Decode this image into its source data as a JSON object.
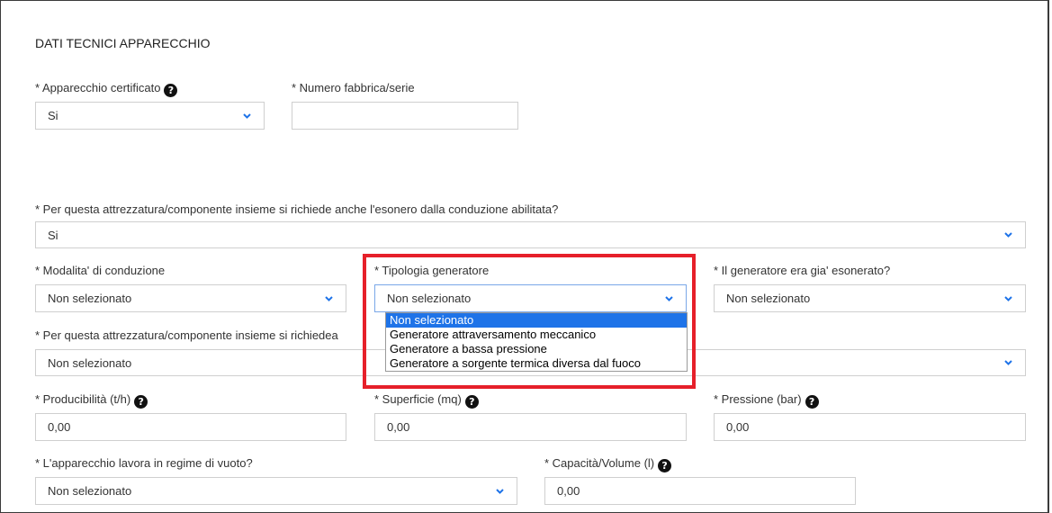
{
  "section_title": "DATI TECNICI APPARECCHIO",
  "fields": {
    "apparecchio_certificato": {
      "label": "* Apparecchio certificato",
      "value": "Si"
    },
    "numero_fabbrica": {
      "label": "* Numero fabbrica/serie",
      "value": ""
    },
    "esonero_conduzione": {
      "label": "* Per questa attrezzatura/componente insieme si richiede anche l'esonero dalla conduzione abilitata?",
      "value": "Si"
    },
    "modalita_conduzione": {
      "label": "* Modalita' di conduzione",
      "value": "Non selezionato"
    },
    "tipologia_generatore": {
      "label": "* Tipologia generatore",
      "value": "Non selezionato",
      "options": [
        "Non selezionato",
        "Generatore attraversamento meccanico",
        "Generatore a bassa pressione",
        "Generatore a sorgente termica diversa dal fuoco"
      ]
    },
    "generatore_esonerato": {
      "label": "* Il generatore era gia' esonerato?",
      "value": "Non selezionato"
    },
    "richiede_altro": {
      "label": "* Per questa attrezzatura/componente insieme si richiede",
      "label_hidden_suffix": "a",
      "value": "Non selezionato"
    },
    "producibilita": {
      "label": "* Producibilità (t/h)",
      "value": "0,00"
    },
    "superficie": {
      "label": "* Superficie (mq)",
      "value": "0,00"
    },
    "pressione": {
      "label": "* Pressione (bar)",
      "value": "0,00"
    },
    "regime_vuoto": {
      "label": "* L'apparecchio lavora in regime di vuoto?",
      "value": "Non selezionato"
    },
    "capacita_volume": {
      "label": "* Capacità/Volume (l)",
      "value": "0,00"
    }
  },
  "icons": {
    "help": "question-circle-icon",
    "chevron": "chevron-down-icon"
  },
  "colors": {
    "accent": "#1e73e8",
    "highlight": "#e6202a",
    "border": "#cfcfcf"
  }
}
